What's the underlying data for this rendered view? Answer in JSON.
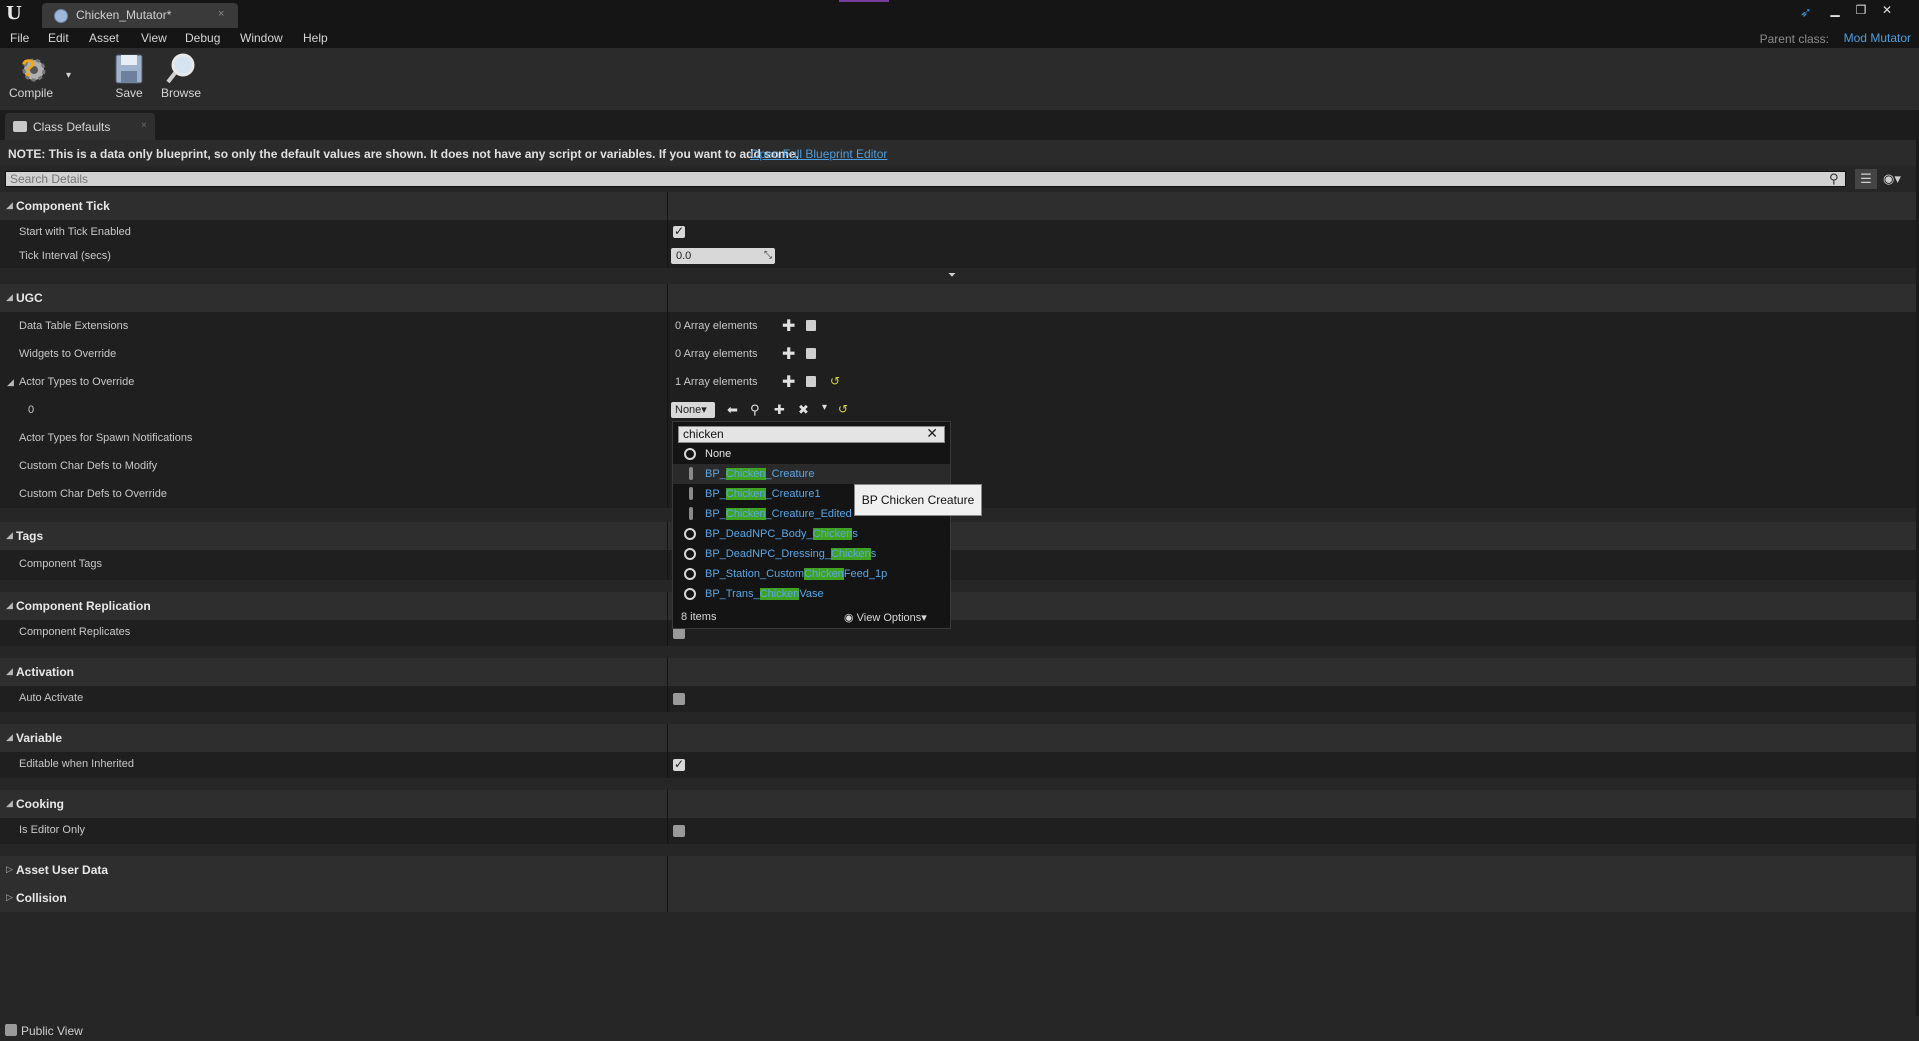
{
  "window": {
    "doc_tab_label": "Chicken_Mutator*",
    "tab_close": "×",
    "logo": "U",
    "minimize": "▁",
    "restore": "❐",
    "close": "✕"
  },
  "menu": {
    "items": [
      "File",
      "Edit",
      "Asset",
      "View",
      "Debug",
      "Window",
      "Help"
    ]
  },
  "parent_class": {
    "label": "Parent class:",
    "value": "Mod Mutator"
  },
  "toolbar": {
    "compile": "Compile",
    "save": "Save",
    "browse": "Browse",
    "compile_dropdown": "▾"
  },
  "panel_tab": {
    "label": "Class Defaults",
    "close": "×"
  },
  "note": {
    "text": "NOTE: This is a data only blueprint, so only the default values are shown.  It does not have any script or variables.  If you want to add some,",
    "link": "Open Full Blueprint Editor"
  },
  "search": {
    "placeholder": "Search Details"
  },
  "categories": {
    "component_tick": "Component Tick",
    "ugc": "UGC",
    "tags": "Tags",
    "component_replication": "Component Replication",
    "activation": "Activation",
    "variable": "Variable",
    "cooking": "Cooking",
    "asset_user_data": "Asset User Data",
    "collision": "Collision"
  },
  "properties": {
    "start_with_tick": "Start with Tick Enabled",
    "tick_interval": "Tick Interval (secs)",
    "tick_interval_value": "0.0",
    "data_table_ext": "Data Table Extensions",
    "widgets_override": "Widgets to Override",
    "actor_types_override": "Actor Types to Override",
    "index_0": "0",
    "actor_types_spawn": "Actor Types for Spawn Notifications",
    "custom_char_modify": "Custom Char Defs to Modify",
    "custom_char_override": "Custom Char Defs to Override",
    "component_tags": "Component Tags",
    "component_replicates": "Component Replicates",
    "auto_activate": "Auto Activate",
    "editable_inherited": "Editable when Inherited",
    "is_editor_only": "Is Editor Only"
  },
  "values": {
    "zero_elements": "0 Array elements",
    "one_element": "1 Array elements",
    "none_dropdown": "None▾",
    "start_with_tick_checked": true,
    "component_replicates_checked": false,
    "auto_activate_checked": false,
    "editable_inherited_checked": true,
    "is_editor_only_checked": false
  },
  "picker": {
    "query": "chicken",
    "items": [
      {
        "pre": "None",
        "match": "",
        "post": "",
        "type": "none"
      },
      {
        "pre": "BP_",
        "match": "Chicken",
        "post": "_Creature",
        "type": "bp"
      },
      {
        "pre": "BP_",
        "match": "Chicken",
        "post": "_Creature1",
        "type": "bp"
      },
      {
        "pre": "BP_",
        "match": "Chicken",
        "post": "_Creature_Edited",
        "type": "bp"
      },
      {
        "pre": "BP_DeadNPC_Body_",
        "match": "Chicken",
        "post": "s",
        "type": "class"
      },
      {
        "pre": "BP_DeadNPC_Dressing_",
        "match": "Chicken",
        "post": "s",
        "type": "class"
      },
      {
        "pre": "BP_Station_Custom",
        "match": "Chicken",
        "post": "Feed_1p",
        "type": "class"
      },
      {
        "pre": "BP_Trans_",
        "match": "Chicken",
        "post": "Vase",
        "type": "class"
      }
    ],
    "count": "8 items",
    "view_options": "View Options▾",
    "tooltip": "BP Chicken Creature"
  },
  "footer": {
    "public_view": "Public View"
  },
  "colors": {
    "accent_link": "#4e9ee0",
    "highlight": "#3ea321",
    "background": "#262626"
  }
}
